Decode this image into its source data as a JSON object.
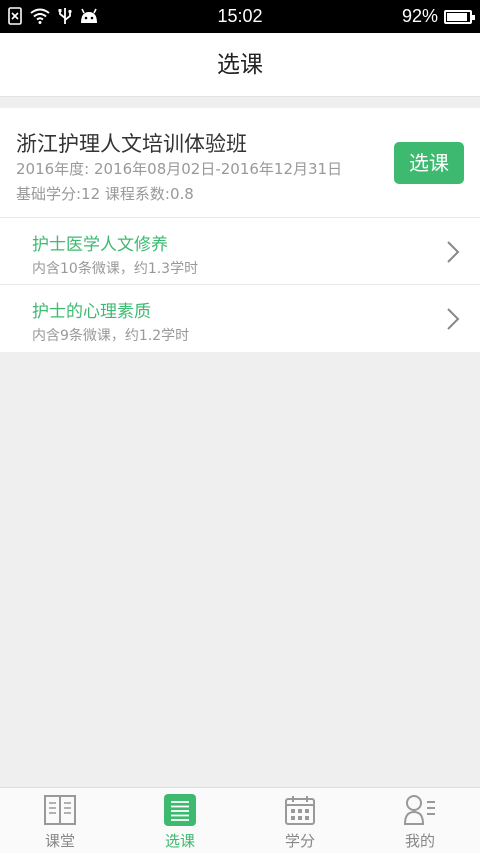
{
  "status_bar": {
    "time": "15:02",
    "battery_text": "92%",
    "battery_level": 0.92
  },
  "header": {
    "title": "选课"
  },
  "class_card": {
    "name": "浙江护理人文培训体验班",
    "period": "2016年度: 2016年08月02日-2016年12月31日",
    "credits": "基础学分:12 课程系数:0.8",
    "enroll_label": "选课"
  },
  "courses": [
    {
      "name": "护士医学人文修养",
      "info": "内含10条微课，约1.3学时"
    },
    {
      "name": "护士的心理素质",
      "info": "内含9条微课，约1.2学时"
    }
  ],
  "tabs": [
    {
      "label": "课堂",
      "icon": "book-icon",
      "active": false
    },
    {
      "label": "选课",
      "icon": "list-icon",
      "active": true
    },
    {
      "label": "学分",
      "icon": "calendar-icon",
      "active": false
    },
    {
      "label": "我的",
      "icon": "profile-icon",
      "active": false
    }
  ],
  "colors": {
    "accent": "#3dba70",
    "status_bar": "#000000",
    "background": "#efefef"
  }
}
